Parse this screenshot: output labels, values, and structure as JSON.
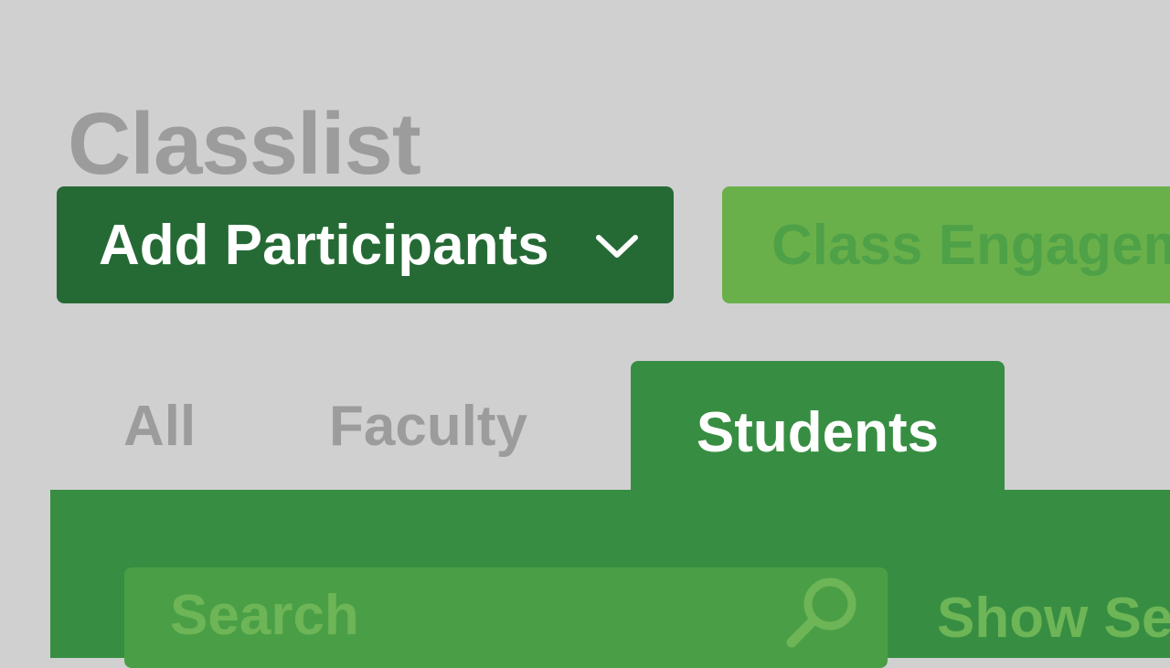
{
  "page": {
    "title": "Classlist"
  },
  "toolbar": {
    "add_participants_label": "Add Participants",
    "add_participants_icon": "chevron-down-icon",
    "class_engagement_label": "Class Engagem"
  },
  "tabs": [
    {
      "label": "All",
      "selected": false
    },
    {
      "label": "Faculty",
      "selected": false
    },
    {
      "label": "Students",
      "selected": true
    }
  ],
  "search": {
    "placeholder": "Search",
    "value": "",
    "icon": "search-icon"
  },
  "show_settings_label": "Show Se",
  "colors": {
    "background": "#d0d0d1",
    "primary_button": "#256a35",
    "secondary_button": "#6ab04a",
    "panel": "#378e42",
    "search_field": "#4a9f46",
    "muted_text": "#9c9c9c"
  }
}
